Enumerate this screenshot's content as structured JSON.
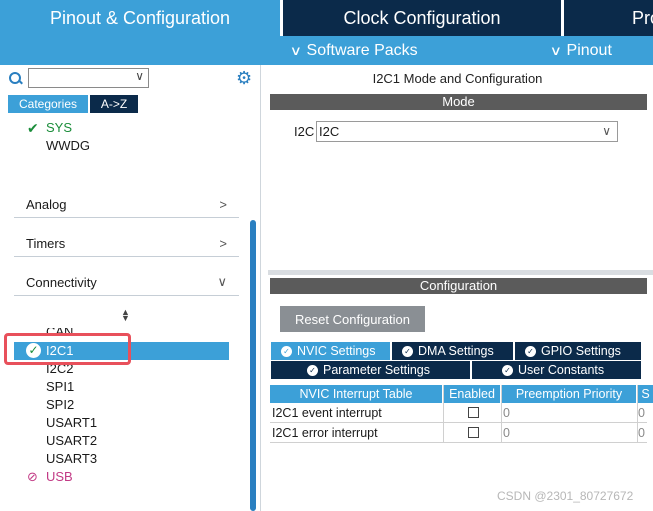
{
  "top_tabs": {
    "pinout": "Pinout & Configuration",
    "clock": "Clock Configuration",
    "project": "Pro"
  },
  "sub_bar": {
    "software_packs": "Software Packs",
    "pinout": "Pinout"
  },
  "left_panel": {
    "search": {
      "value": ""
    },
    "category_tabs": {
      "categories": "Categories",
      "az": "A->Z"
    },
    "system_items": [
      {
        "label": "SYS",
        "status": "configured"
      },
      {
        "label": "WWDG",
        "status": "none"
      }
    ],
    "groups": {
      "analog": "Analog",
      "timers": "Timers",
      "connectivity": "Connectivity"
    },
    "connectivity_items": {
      "can": "CAN",
      "i2c1": "I2C1",
      "i2c2": "I2C2",
      "spi1": "SPI1",
      "spi2": "SPI2",
      "usart1": "USART1",
      "usart2": "USART2",
      "usart3": "USART3",
      "usb": "USB"
    }
  },
  "right_panel": {
    "title": "I2C1 Mode and Configuration",
    "mode_header": "Mode",
    "i2c_field": {
      "label": "I2C",
      "value": "I2C"
    },
    "config_header": "Configuration",
    "reset_button": "Reset Configuration",
    "settings_tabs": {
      "nvic": "NVIC Settings",
      "dma": "DMA Settings",
      "gpio": "GPIO Settings",
      "parameter": "Parameter Settings",
      "user_constants": "User Constants"
    },
    "table": {
      "headers": [
        "NVIC Interrupt Table",
        "Enabled",
        "Preemption Priority",
        "S"
      ],
      "rows": [
        {
          "name": "I2C1 event interrupt",
          "enabled": false,
          "priority": "0",
          "sub": "0"
        },
        {
          "name": "I2C1 error interrupt",
          "enabled": false,
          "priority": "0",
          "sub": "0"
        }
      ]
    }
  },
  "watermark": "CSDN @2301_80727672",
  "colors": {
    "accent_blue": "#3ca0d8",
    "dark_navy": "#0b2a4a",
    "green_ok": "#1a8d3a",
    "pink_disabled": "#c23a85",
    "highlight_red": "#e8505b"
  }
}
